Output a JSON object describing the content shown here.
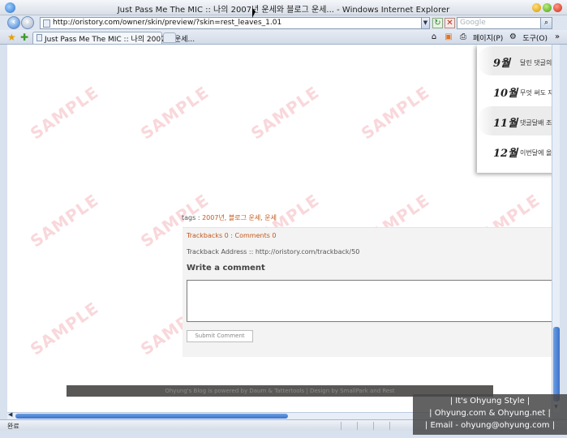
{
  "window": {
    "title": "Just Pass Me The MIC :: 나의 2007년 운세와 블로그 운세... - Windows Internet Explorer"
  },
  "address_bar": {
    "url": "http://oristory.com/owner/skin/preview/?skin=rest_leaves_1.01"
  },
  "search_box": {
    "placeholder": "Google"
  },
  "tab": {
    "label": "Just Pass Me The MIC :: 나의 2007년 운세..."
  },
  "command_bar": {
    "page_label": "페이지(P)",
    "tools_label": "도구(O)"
  },
  "calendar": [
    {
      "month": "9월",
      "text": "달린 댓글의 갯"
    },
    {
      "month": "10월",
      "text": "무엇 써도 재"
    },
    {
      "month": "11월",
      "text": "댓글달배 조"
    },
    {
      "month": "12월",
      "text": "이번달에 올"
    }
  ],
  "post": {
    "tags_label": "tags : ",
    "tags_value": "2007년, 블로그 운세, 운세",
    "trackback_line": "Trackbacks 0 : Comments 0",
    "trackback_address": "Trackback Address :: http://oristory.com/trackback/50",
    "write_title": "Write a comment",
    "submit_label": "Submit Comment"
  },
  "footer": {
    "text": "Ohyung's Blog is powered by Daum & Tattertools | Design by SmallPark and Rest"
  },
  "status_bar": {
    "text": "완료"
  },
  "watermark": {
    "text": "SAMPLE"
  },
  "signature": {
    "line1": "| It's Ohyung Style |",
    "line2": "| Ohyung.com & Ohyung.net |",
    "line3": "| Email - ohyung@ohyung.com |"
  }
}
